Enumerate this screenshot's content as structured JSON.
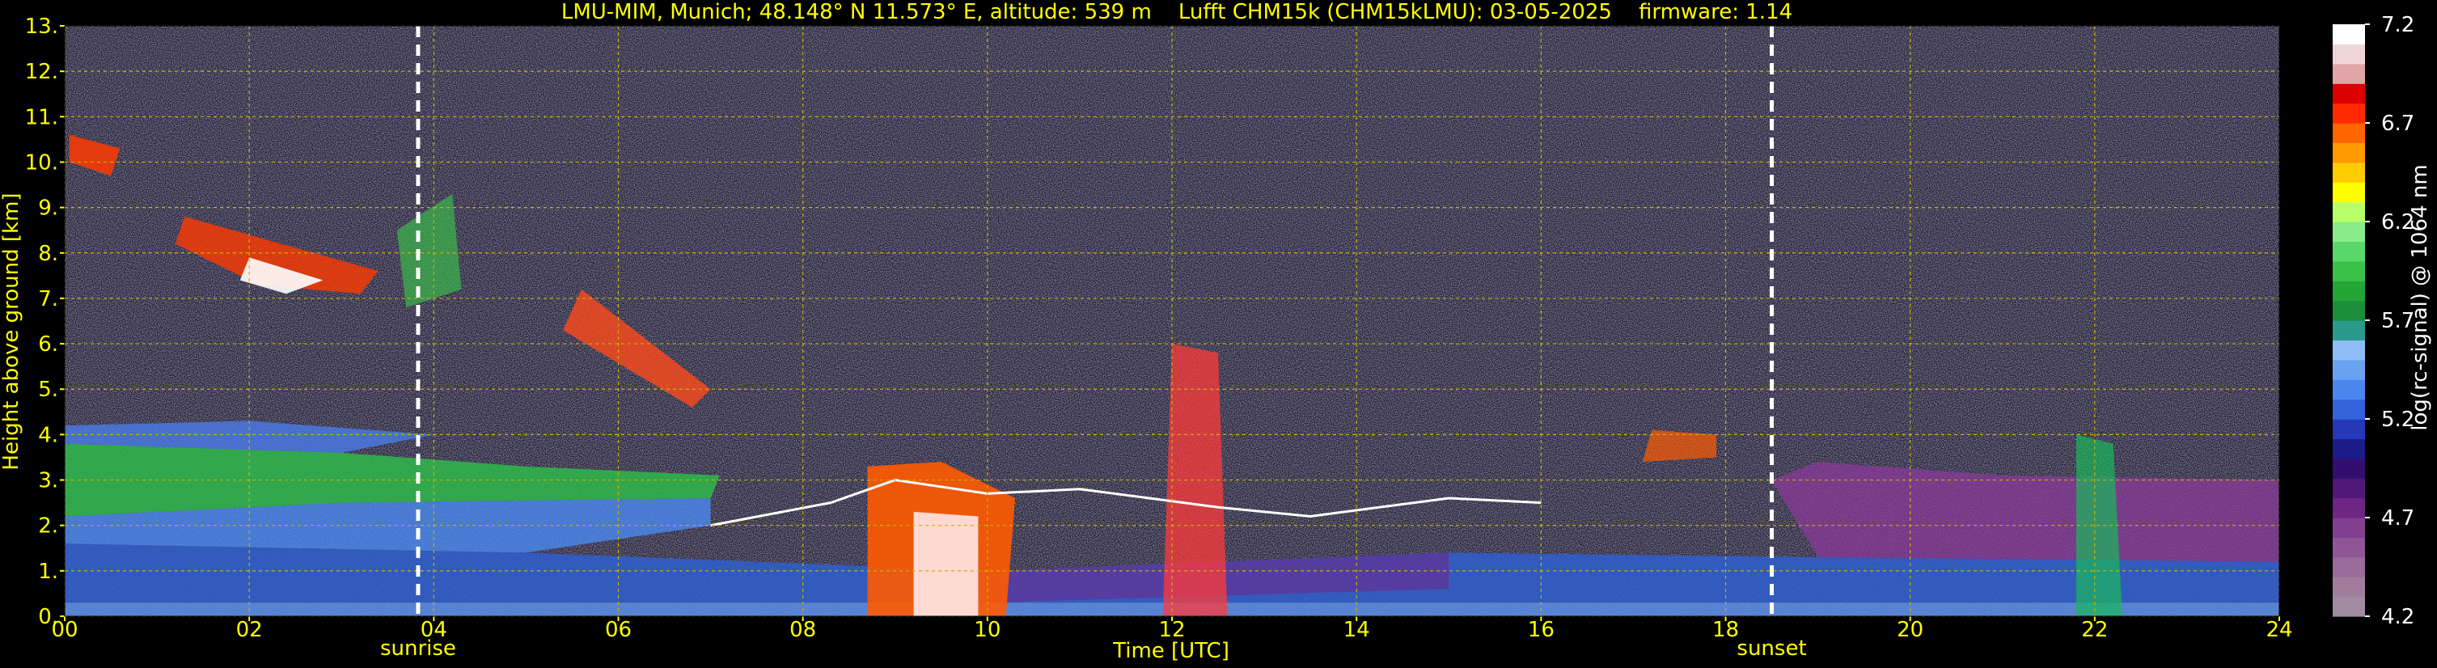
{
  "title": {
    "site": "LMU-MIM, Munich; 48.148° N 11.573° E, altitude: 539 m",
    "instrument": "Lufft CHM15k (CHM15kLMU): 03-05-2025",
    "firmware": "firmware: 1.14"
  },
  "colors": {
    "background": "#000000",
    "text": "#ffff00",
    "grid": "#c8b400",
    "marker": "#ffffff",
    "colorbar_text": "#ffffff"
  },
  "chart_data": {
    "type": "heatmap",
    "xlabel": "Time [UTC]",
    "ylabel": "Height above ground [km]",
    "xlim": [
      0,
      24
    ],
    "ylim": [
      0,
      13
    ],
    "x_ticks": [
      "00",
      "02",
      "04",
      "06",
      "08",
      "10",
      "12",
      "14",
      "16",
      "18",
      "20",
      "22",
      "24"
    ],
    "y_ticks": [
      "0.",
      "1.",
      "2.",
      "3.",
      "4.",
      "5.",
      "6.",
      "7.",
      "8.",
      "9.",
      "10.",
      "11.",
      "12.",
      "13."
    ],
    "grid": true,
    "markers": [
      {
        "label": "sunrise",
        "time_h": 3.83
      },
      {
        "label": "sunset",
        "time_h": 18.5
      }
    ],
    "colorbar": {
      "label": "log(rc-signal) @ 1064 nm",
      "range": [
        4.2,
        7.2
      ],
      "ticks": [
        "4.2",
        "4.7",
        "5.2",
        "5.7",
        "6.2",
        "6.7",
        "7.2"
      ],
      "colors": [
        "#a08aa0",
        "#a07d9b",
        "#9a6a98",
        "#8f5595",
        "#823e8f",
        "#6e2684",
        "#501778",
        "#330d70",
        "#1d1a8a",
        "#2438b8",
        "#3464dc",
        "#4a86ee",
        "#6aa2f2",
        "#8fbdf5",
        "#2a9a8a",
        "#1a8e3a",
        "#23a634",
        "#3ac24a",
        "#5ad86a",
        "#88ec8a",
        "#b8ff6a",
        "#ffff00",
        "#ffcc00",
        "#ff9a00",
        "#ff6600",
        "#ff2a00",
        "#dd0000",
        "#e3a4a8",
        "#efd4d6",
        "#ffffff"
      ]
    }
  }
}
